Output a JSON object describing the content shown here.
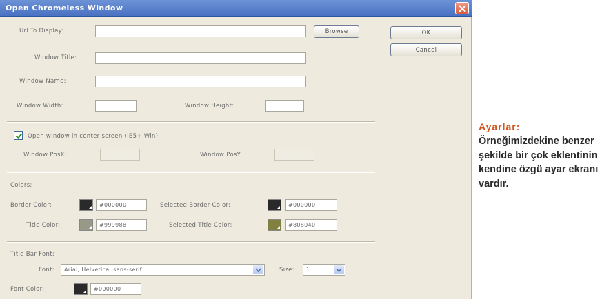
{
  "dialog": {
    "title": "Open Chromeless Window",
    "url_label": "Url To Display:",
    "url_value": "",
    "browse_label": "Browse",
    "ok_label": "OK",
    "cancel_label": "Cancel",
    "window_title_label": "Window Title:",
    "window_name_label": "Window Name:",
    "window_width_label": "Window Width:",
    "window_height_label": "Window Height:",
    "center_label": "Open window in center screen (IE5+ Win)",
    "center_checked": true,
    "posx_label": "Window PosX:",
    "posy_label": "Window PosY:",
    "colors_label": "Colors:",
    "border_color_label": "Border Color:",
    "border_color_value": "#000000",
    "selected_border_label": "Selected Border Color:",
    "selected_border_value": "#000000",
    "title_color_label": "Title Color:",
    "title_color_value": "#999988",
    "selected_title_label": "Selected Title Color:",
    "selected_title_value": "#808040",
    "title_bar_font_label": "Title Bar Font:",
    "font_label": "Font:",
    "font_value": "Arial, Helvetica, sans-serif",
    "size_label": "Size:",
    "size_value": "1",
    "font_color_label": "Font Color:",
    "font_color_value": "#000000"
  },
  "sidebar": {
    "heading": "Ayarlar:",
    "body": "Örneğimizdekine benzer şekilde bir çok eklentinin kendine özgü ayar ekranı vardır."
  },
  "colors": {
    "accent": "#d0551b",
    "titlebar": "#4a72c2",
    "swatch_black": "#2a2a2a",
    "swatch_gray": "#999988",
    "swatch_olive": "#808040"
  },
  "icons": {
    "close": "close-icon",
    "check": "check-icon",
    "dropdown": "chevron-down-icon"
  }
}
